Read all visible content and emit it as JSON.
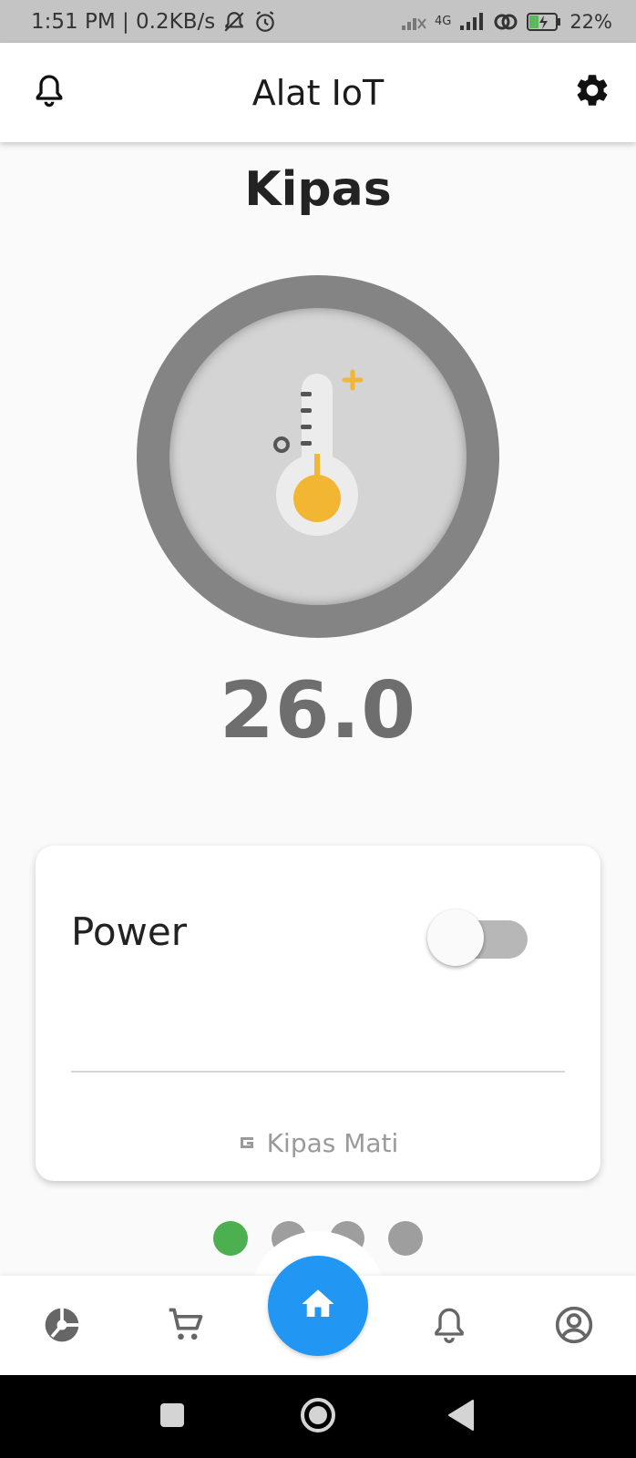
{
  "status_bar": {
    "time_speed": "1:51 PM | 0.2KB/s",
    "network": "4G",
    "battery": "22%"
  },
  "app_bar": {
    "title": "Alat IoT"
  },
  "device": {
    "name": "Kipas",
    "temperature": "26.0"
  },
  "power_card": {
    "label": "Power",
    "toggle_on": false,
    "status": "Kipas Mati"
  },
  "pager": {
    "count": 4,
    "active_index": 0
  },
  "colors": {
    "accent": "#2196f3",
    "active_dot": "#4caf50",
    "thermometer_bulb": "#f2b632",
    "gauge_ring": "#848484"
  },
  "icons": {
    "app_left": "bell-icon",
    "app_right": "gear-icon",
    "nav": [
      "pie-chart-icon",
      "cart-icon",
      "home-icon",
      "bell-icon",
      "account-icon"
    ]
  }
}
